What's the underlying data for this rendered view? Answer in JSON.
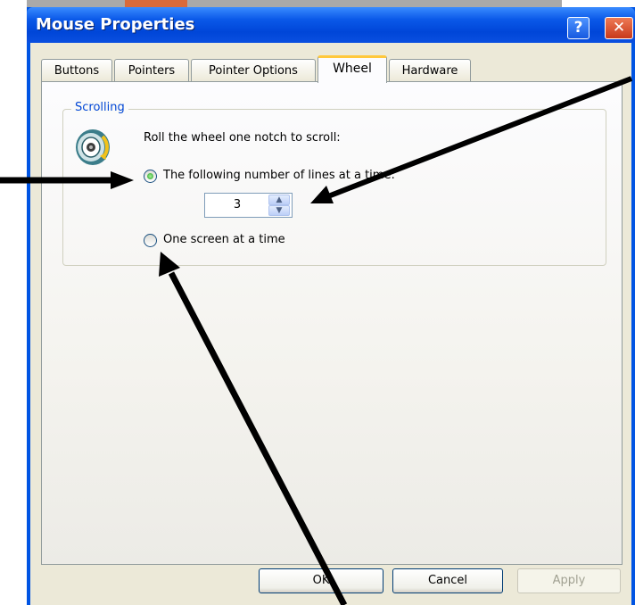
{
  "window": {
    "title": "Mouse Properties",
    "help_glyph": "?",
    "close_glyph": "✕"
  },
  "tabs": [
    {
      "label": "Buttons",
      "active": false
    },
    {
      "label": "Pointers",
      "active": false
    },
    {
      "label": "Pointer Options",
      "active": false
    },
    {
      "label": "Wheel",
      "active": true
    },
    {
      "label": "Hardware",
      "active": false
    }
  ],
  "scrolling": {
    "group_label": "Scrolling",
    "icon": "mouse-wheel-icon",
    "description": "Roll the wheel one notch to scroll:",
    "option_lines": {
      "label": "The following number of lines at a time:",
      "checked": true
    },
    "lines_value": "3",
    "option_screen": {
      "label": "One screen at a time",
      "checked": false
    }
  },
  "buttons": {
    "ok": "OK",
    "cancel": "Cancel",
    "apply": "Apply"
  },
  "colors": {
    "titlebar": "#0054e3",
    "tab_highlight": "#ffc83c",
    "group_label": "#0046d5",
    "radio_dot": "#21a121"
  }
}
